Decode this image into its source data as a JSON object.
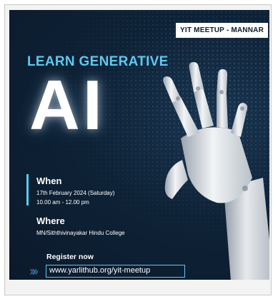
{
  "poster": {
    "badge": "YIT MEETUP - MANNAR",
    "headline": "LEARN GENERATIVE",
    "big_title": "AI",
    "when_label": "When",
    "date": "17th February 2024 (Saturday)",
    "time": "10.00 am - 12.00 pm",
    "where_label": "Where",
    "venue": "MN/Siththivinayakar Hindu College",
    "register_label": "Register now",
    "url": "www.yarlithub.org/yit-meetup"
  },
  "colors": {
    "background": "#0e2236",
    "accent": "#5ec9f0",
    "text": "#ffffff"
  },
  "icons": {
    "chevrons": "double-chevron-right-icon",
    "hand": "robot-hand-illustration"
  }
}
